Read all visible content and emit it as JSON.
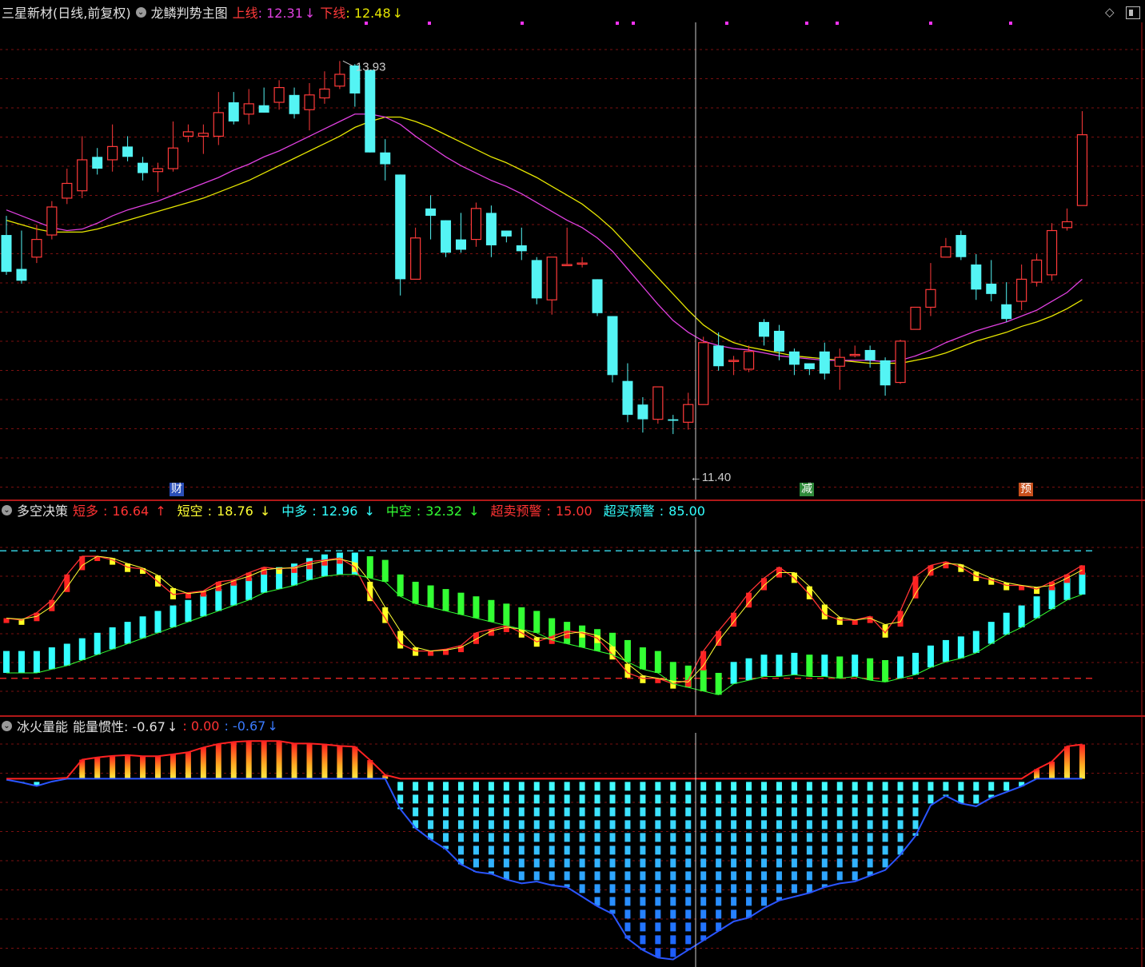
{
  "main": {
    "title": "三星新材(日线,前复权)",
    "indicator": "龙鳞判势主图",
    "upper_label": "上线",
    "upper_value": "12.31",
    "upper_arrow": "↓",
    "lower_label": "下线",
    "lower_value": "12.48",
    "lower_arrow": "↓",
    "high_label": "13.93",
    "low_label": "11.40",
    "markers": [
      {
        "text": "财",
        "color": "#2a4fb8"
      },
      {
        "text": "减",
        "color": "#2f8a3a"
      },
      {
        "text": "预",
        "color": "#c8501c"
      }
    ],
    "colors": {
      "up": "#ff3a3a",
      "down": "#54f4f4",
      "ma_fast": "#e040e0",
      "ma_slow": "#e6e600"
    }
  },
  "duokong": {
    "title": "多空决策",
    "items": [
      {
        "label": "短多",
        "value": "16.64",
        "arrow": "↑",
        "color": "#ff3333"
      },
      {
        "label": "短空",
        "value": "18.76",
        "arrow": "↓",
        "color": "#ffff33"
      },
      {
        "label": "中多",
        "value": "12.96",
        "arrow": "↓",
        "color": "#33ffff"
      },
      {
        "label": "中空",
        "value": "32.32",
        "arrow": "↓",
        "color": "#33ff33"
      },
      {
        "label": "超卖预警",
        "value": "15.00",
        "arrow": "",
        "color": "#ff3333"
      },
      {
        "label": "超买预警",
        "value": "85.00",
        "arrow": "",
        "color": "#33ffff"
      }
    ]
  },
  "energy": {
    "title": "冰火量能",
    "label": "能量惯性",
    "value1": "-0.67",
    "arrow1": "↓",
    "value2": "0.00",
    "value3": "-0.67",
    "arrow3": "↓"
  },
  "window": {
    "diamond_icon": "diamond-icon",
    "restore_icon": "window-restore-icon"
  },
  "chart_data": [
    {
      "type": "candlestick",
      "name": "main",
      "ylim": [
        11.2,
        14.1
      ],
      "candles": [
        [
          12.75,
          12.5,
          12.88,
          12.48
        ],
        [
          12.52,
          12.44,
          12.78,
          12.42
        ],
        [
          12.6,
          12.72,
          12.82,
          12.56
        ],
        [
          12.75,
          12.94,
          12.98,
          12.72
        ],
        [
          13.0,
          13.1,
          13.2,
          12.96
        ],
        [
          13.05,
          13.26,
          13.42,
          13.0
        ],
        [
          13.28,
          13.2,
          13.34,
          13.16
        ],
        [
          13.26,
          13.35,
          13.5,
          13.18
        ],
        [
          13.35,
          13.28,
          13.42,
          13.25
        ],
        [
          13.24,
          13.17,
          13.28,
          13.12
        ],
        [
          13.18,
          13.2,
          13.24,
          13.04
        ],
        [
          13.2,
          13.34,
          13.52,
          13.18
        ],
        [
          13.42,
          13.45,
          13.5,
          13.38
        ],
        [
          13.42,
          13.44,
          13.5,
          13.3
        ],
        [
          13.42,
          13.58,
          13.72,
          13.36
        ],
        [
          13.65,
          13.52,
          13.72,
          13.5
        ],
        [
          13.57,
          13.64,
          13.74,
          13.5
        ],
        [
          13.63,
          13.58,
          13.75,
          13.58
        ],
        [
          13.65,
          13.75,
          13.8,
          13.6
        ],
        [
          13.7,
          13.57,
          13.75,
          13.54
        ],
        [
          13.6,
          13.7,
          13.78,
          13.46
        ],
        [
          13.68,
          13.74,
          13.86,
          13.64
        ],
        [
          13.76,
          13.84,
          13.93,
          13.74
        ],
        [
          13.9,
          13.71,
          13.91,
          13.62
        ],
        [
          13.87,
          13.31,
          13.87,
          13.31
        ],
        [
          13.31,
          13.23,
          13.4,
          13.12
        ],
        [
          13.16,
          12.45,
          13.16,
          12.34
        ],
        [
          12.45,
          12.73,
          12.8,
          12.45
        ],
        [
          12.93,
          12.88,
          13.02,
          12.72
        ],
        [
          12.85,
          12.63,
          12.85,
          12.6
        ],
        [
          12.72,
          12.65,
          12.9,
          12.63
        ],
        [
          12.72,
          12.93,
          12.97,
          12.67
        ],
        [
          12.9,
          12.68,
          12.95,
          12.6
        ],
        [
          12.78,
          12.74,
          12.78,
          12.7
        ],
        [
          12.68,
          12.64,
          12.8,
          12.58
        ],
        [
          12.58,
          12.32,
          12.6,
          12.28
        ],
        [
          12.31,
          12.6,
          12.6,
          12.21
        ],
        [
          12.55,
          12.55,
          12.8,
          12.54
        ],
        [
          12.56,
          12.56,
          12.6,
          12.53
        ],
        [
          12.45,
          12.22,
          12.45,
          12.2
        ],
        [
          12.2,
          11.8,
          12.2,
          11.75
        ],
        [
          11.76,
          11.53,
          11.88,
          11.48
        ],
        [
          11.6,
          11.5,
          11.65,
          11.41
        ],
        [
          11.5,
          11.72,
          11.72,
          11.47
        ],
        [
          11.5,
          11.49,
          11.53,
          11.4
        ],
        [
          11.48,
          11.6,
          11.68,
          11.43
        ],
        [
          11.6,
          12.02,
          12.06,
          11.6
        ],
        [
          12.0,
          11.86,
          12.09,
          11.83
        ],
        [
          11.9,
          11.9,
          11.93,
          11.8
        ],
        [
          11.84,
          11.96,
          12.0,
          11.82
        ],
        [
          12.16,
          12.06,
          12.18,
          12.0
        ],
        [
          12.1,
          11.96,
          12.14,
          11.9
        ],
        [
          11.96,
          11.87,
          11.98,
          11.8
        ],
        [
          11.88,
          11.84,
          11.88,
          11.8
        ],
        [
          11.96,
          11.81,
          12.02,
          11.77
        ],
        [
          11.86,
          11.92,
          11.98,
          11.7
        ],
        [
          11.94,
          11.94,
          12.0,
          11.92
        ],
        [
          11.97,
          11.9,
          12.0,
          11.85
        ],
        [
          11.9,
          11.73,
          11.92,
          11.66
        ],
        [
          11.75,
          12.03,
          12.04,
          11.74
        ],
        [
          12.11,
          12.26,
          12.26,
          12.11
        ],
        [
          12.26,
          12.38,
          12.56,
          12.2
        ],
        [
          12.6,
          12.67,
          12.73,
          12.62
        ],
        [
          12.75,
          12.6,
          12.78,
          12.58
        ],
        [
          12.55,
          12.38,
          12.62,
          12.31
        ],
        [
          12.42,
          12.35,
          12.58,
          12.3
        ],
        [
          12.28,
          12.18,
          12.43,
          12.16
        ],
        [
          12.3,
          12.45,
          12.55,
          12.24
        ],
        [
          12.43,
          12.58,
          12.62,
          12.4
        ],
        [
          12.48,
          12.78,
          12.83,
          12.44
        ],
        [
          12.8,
          12.84,
          12.93,
          12.78
        ],
        [
          12.95,
          13.43,
          13.59,
          12.95
        ]
      ],
      "ma_fast": [
        12.92,
        12.88,
        12.84,
        12.8,
        12.78,
        12.79,
        12.83,
        12.88,
        12.92,
        12.95,
        12.98,
        13.02,
        13.06,
        13.1,
        13.14,
        13.19,
        13.23,
        13.28,
        13.32,
        13.37,
        13.42,
        13.47,
        13.52,
        13.57,
        13.57,
        13.55,
        13.5,
        13.42,
        13.35,
        13.28,
        13.22,
        13.17,
        13.12,
        13.08,
        13.03,
        12.97,
        12.91,
        12.85,
        12.8,
        12.73,
        12.64,
        12.52,
        12.4,
        12.28,
        12.17,
        12.09,
        12.03,
        12.0,
        11.98,
        11.97,
        11.95,
        11.93,
        11.92,
        11.91,
        11.9,
        11.9,
        11.9,
        11.9,
        11.89,
        11.9,
        11.93,
        11.97,
        12.02,
        12.06,
        12.1,
        12.13,
        12.16,
        12.2,
        12.24,
        12.3,
        12.36,
        12.45
      ],
      "ma_slow": [
        12.85,
        12.82,
        12.79,
        12.77,
        12.77,
        12.77,
        12.79,
        12.82,
        12.85,
        12.88,
        12.91,
        12.94,
        12.97,
        13.0,
        13.04,
        13.08,
        13.12,
        13.17,
        13.22,
        13.27,
        13.32,
        13.37,
        13.42,
        13.48,
        13.52,
        13.55,
        13.55,
        13.52,
        13.48,
        13.43,
        13.38,
        13.33,
        13.28,
        13.24,
        13.19,
        13.14,
        13.08,
        13.02,
        12.96,
        12.88,
        12.79,
        12.68,
        12.57,
        12.46,
        12.35,
        12.24,
        12.14,
        12.07,
        12.02,
        11.99,
        11.97,
        11.95,
        11.93,
        11.92,
        11.91,
        11.9,
        11.89,
        11.88,
        11.88,
        11.88,
        11.9,
        11.92,
        11.95,
        11.99,
        12.03,
        12.06,
        12.09,
        12.13,
        12.16,
        12.2,
        12.25,
        12.31
      ]
    },
    {
      "type": "bar",
      "name": "duokong",
      "ylim": [
        0,
        100
      ],
      "overbought": 85,
      "oversold": 15,
      "short": [
        48,
        47,
        51,
        58,
        72,
        82,
        82,
        80,
        76,
        75,
        68,
        61,
        62,
        63,
        68,
        69,
        73,
        76,
        75,
        76,
        79,
        80,
        81,
        76,
        60,
        48,
        34,
        30,
        30,
        31,
        33,
        40,
        42,
        44,
        40,
        35,
        38,
        41,
        40,
        37,
        28,
        18,
        15,
        15,
        12,
        14,
        30,
        41,
        51,
        62,
        70,
        76,
        70,
        61,
        50,
        47,
        47,
        49,
        40,
        52,
        71,
        77,
        79,
        76,
        71,
        69,
        66,
        66,
        64,
        68,
        72,
        77
      ],
      "long": [
        30,
        30,
        30,
        32,
        34,
        37,
        40,
        43,
        46,
        49,
        52,
        55,
        58,
        61,
        64,
        67,
        70,
        74,
        76,
        78,
        81,
        83,
        84,
        84,
        82,
        80,
        72,
        68,
        66,
        64,
        62,
        60,
        58,
        56,
        54,
        52,
        48,
        46,
        44,
        42,
        40,
        36,
        32,
        30,
        24,
        22,
        20,
        18,
        24,
        26,
        28,
        28,
        29,
        28,
        28,
        27,
        28,
        26,
        25,
        27,
        29,
        33,
        36,
        38,
        41,
        46,
        51,
        55,
        60,
        65,
        70,
        73
      ]
    },
    {
      "type": "bar",
      "name": "energy",
      "values": [
        -0.05,
        -0.2,
        -0.38,
        -0.15,
        0.05,
        1.0,
        1.12,
        1.2,
        1.24,
        1.18,
        1.18,
        1.28,
        1.39,
        1.64,
        1.83,
        1.93,
        1.98,
        1.98,
        1.98,
        1.85,
        1.85,
        1.8,
        1.72,
        1.68,
        0.98,
        0.2,
        -1.6,
        -2.6,
        -3.2,
        -3.7,
        -4.5,
        -4.9,
        -5.0,
        -5.3,
        -5.5,
        -5.4,
        -5.6,
        -5.7,
        -6.2,
        -6.7,
        -7.1,
        -8.4,
        -9.0,
        -9.4,
        -9.5,
        -9.0,
        -8.5,
        -8.0,
        -7.5,
        -7.3,
        -6.8,
        -6.4,
        -6.2,
        -6.0,
        -5.7,
        -5.5,
        -5.4,
        -5.1,
        -4.8,
        -4.0,
        -3.0,
        -1.4,
        -0.9,
        -1.3,
        -1.45,
        -1.0,
        -0.7,
        -0.4,
        0.5,
        0.9,
        1.7,
        1.8
      ],
      "ylim": [
        -9.6,
        2.2
      ]
    }
  ]
}
